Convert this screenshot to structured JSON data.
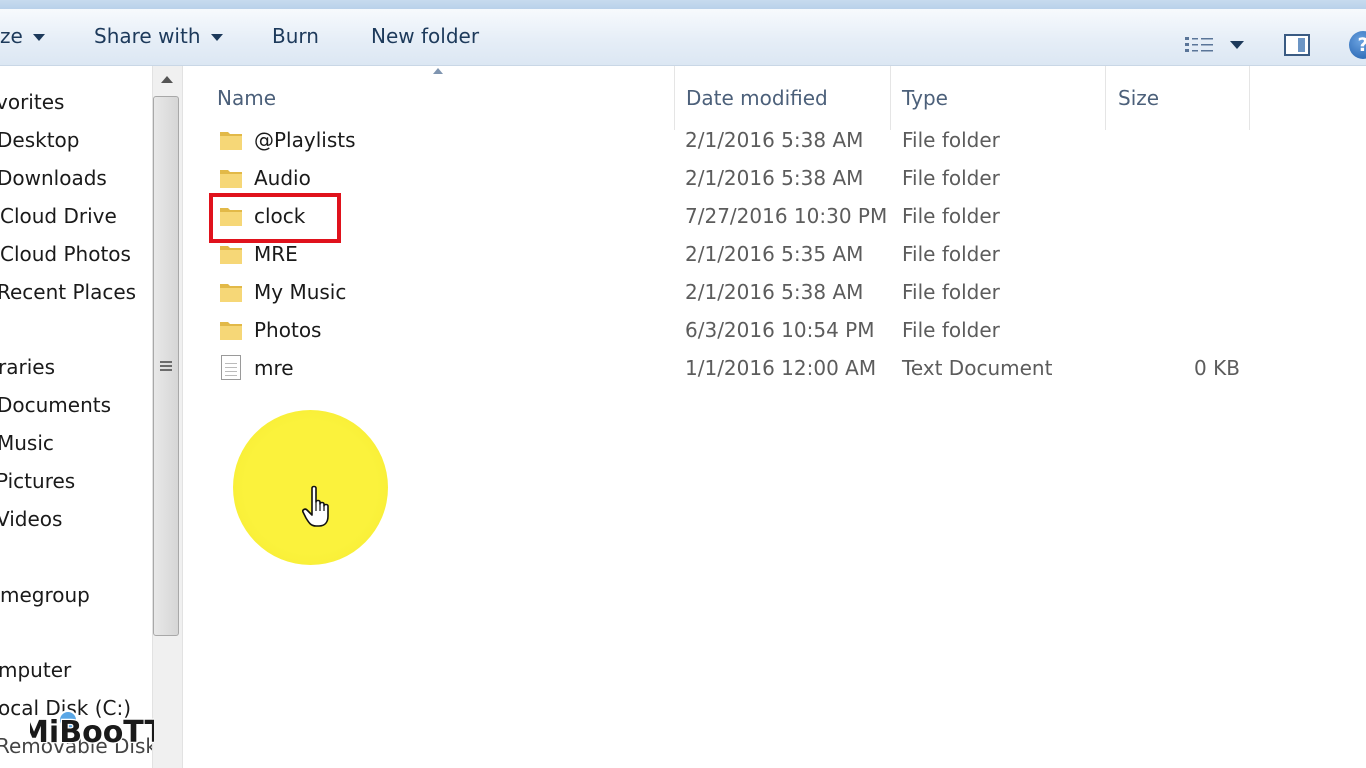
{
  "toolbar": {
    "organize_label": "ze",
    "share_with_label": "Share with",
    "burn_label": "Burn",
    "new_folder_label": "New folder",
    "help_label": "?"
  },
  "nav": {
    "items": [
      {
        "label": "vorites"
      },
      {
        "label": "Desktop"
      },
      {
        "label": "Downloads"
      },
      {
        "label": "Cloud Drive"
      },
      {
        "label": "Cloud Photos"
      },
      {
        "label": "Recent Places"
      },
      {
        "label": "raries"
      },
      {
        "label": "Documents"
      },
      {
        "label": "Music"
      },
      {
        "label": "Pictures"
      },
      {
        "label": "Videos"
      },
      {
        "label": "megroup"
      },
      {
        "label": "mputer"
      },
      {
        "label": "ocal Disk (C:)"
      },
      {
        "label": "Removable Disk"
      }
    ]
  },
  "columns": {
    "name": "Name",
    "date": "Date modified",
    "type": "Type",
    "size": "Size"
  },
  "files": [
    {
      "name": "@Playlists",
      "date": "2/1/2016 5:38 AM",
      "type": "File folder",
      "size": "",
      "icon": "folder-icon"
    },
    {
      "name": "Audio",
      "date": "2/1/2016 5:38 AM",
      "type": "File folder",
      "size": "",
      "icon": "folder-icon"
    },
    {
      "name": "clock",
      "date": "7/27/2016 10:30 PM",
      "type": "File folder",
      "size": "",
      "icon": "folder-icon"
    },
    {
      "name": "MRE",
      "date": "2/1/2016 5:35 AM",
      "type": "File folder",
      "size": "",
      "icon": "folder-icon"
    },
    {
      "name": "My Music",
      "date": "2/1/2016 5:38 AM",
      "type": "File folder",
      "size": "",
      "icon": "folder-icon"
    },
    {
      "name": "Photos",
      "date": "6/3/2016 10:54 PM",
      "type": "File folder",
      "size": "",
      "icon": "folder-icon"
    },
    {
      "name": "mre",
      "date": "1/1/2016 12:00 AM",
      "type": "Text Document",
      "size": "0 KB",
      "icon": "text-file-icon"
    }
  ],
  "watermark": {
    "text": "MiBooTT"
  },
  "colors": {
    "highlight": "#e0121c",
    "cursor_halo": "#fbf23c",
    "toolbar_text": "#1d3a5b",
    "folder": "#f2cf6c"
  }
}
